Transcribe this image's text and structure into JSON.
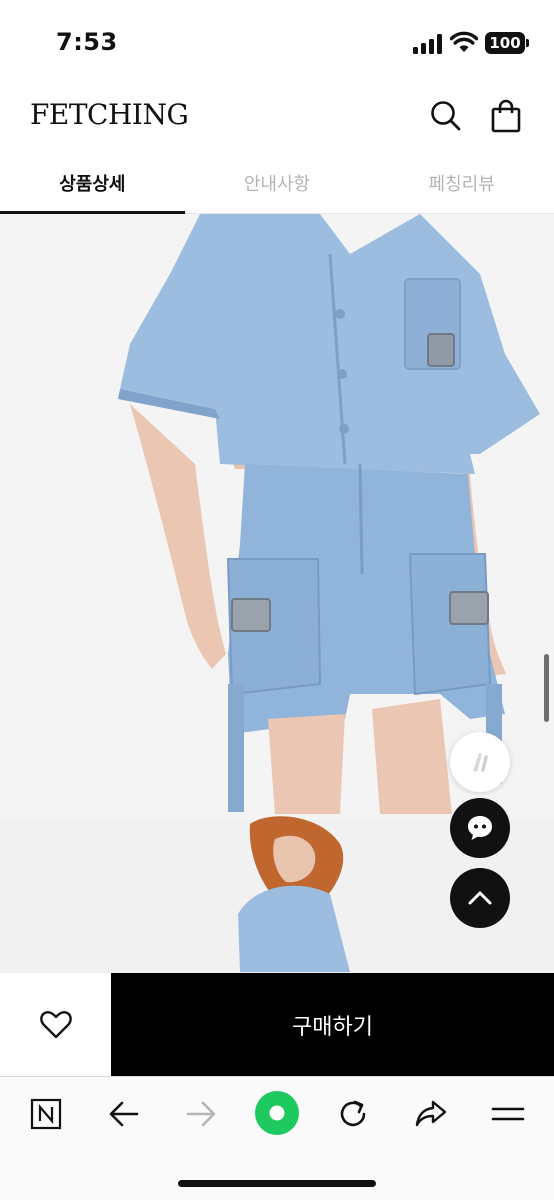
{
  "status_bar": {
    "time": "7:53",
    "battery": "100"
  },
  "header": {
    "logo": "FETCHING",
    "icons": [
      "search-icon",
      "shopping-bag-icon"
    ]
  },
  "tabs": [
    {
      "label": "상품상세",
      "active": true
    },
    {
      "label": "안내사항",
      "active": false
    },
    {
      "label": "페칭리뷰",
      "active": false
    }
  ],
  "floating_buttons": [
    "product-thumbnail",
    "chat-icon",
    "scroll-to-top-icon"
  ],
  "purchase_bar": {
    "buy_label": "구매하기",
    "wish_icon": "heart-icon"
  },
  "browser_toolbar": {
    "icons": [
      "naver-n-icon",
      "back-arrow-icon",
      "forward-arrow-icon",
      "green-dot-icon",
      "reload-icon",
      "share-icon",
      "menu-icon"
    ]
  },
  "colors": {
    "accent_black": "#000000",
    "denim": "#8fb4da",
    "green": "#1ec95f"
  }
}
